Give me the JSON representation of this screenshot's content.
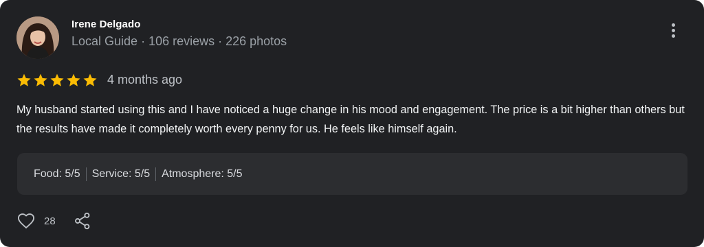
{
  "review": {
    "author_name": "Irene Delgado",
    "author_meta": "Local Guide · 106 reviews · 226 photos",
    "rating": 5,
    "rating_max": 5,
    "time_ago": "4 months ago",
    "text": "My husband started using this and I have noticed a huge change in his mood and engagement. The price is a bit higher than others but the results have made it completely worth every penny for us. He feels like himself again.",
    "attributes": [
      {
        "label": "Food: 5/5"
      },
      {
        "label": "Service: 5/5"
      },
      {
        "label": "Atmosphere: 5/5"
      }
    ],
    "like_count": "28"
  },
  "icons": {
    "star": "star-icon",
    "more": "more-vertical-icon",
    "like": "heart-icon",
    "share": "share-icon"
  },
  "colors": {
    "card_background": "#202124",
    "star": "#fbbc04",
    "attributes_background": "#2c2d30",
    "muted_text": "#9aa0a6"
  }
}
